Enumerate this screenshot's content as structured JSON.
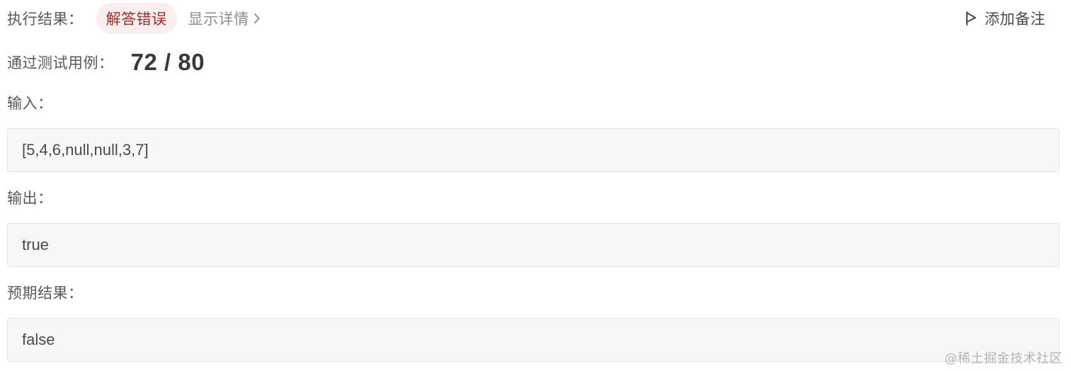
{
  "result": {
    "label": "执行结果：",
    "status": "解答错误",
    "details_link": "显示详情"
  },
  "note_button": {
    "label": "添加备注"
  },
  "passed": {
    "label": "通过测试用例：",
    "count": "72 / 80"
  },
  "input": {
    "label": "输入：",
    "value": "[5,4,6,null,null,3,7]"
  },
  "output": {
    "label": "输出：",
    "value": "true"
  },
  "expected": {
    "label": "预期结果：",
    "value": "false"
  },
  "watermark": "@稀土掘金技术社区",
  "colors": {
    "status_text": "#9b2c2c",
    "status_bg": "#fbeeee",
    "box_bg": "#f7f7f7"
  },
  "icons": {
    "details": "chevron-right-icon",
    "note": "flag-icon"
  }
}
